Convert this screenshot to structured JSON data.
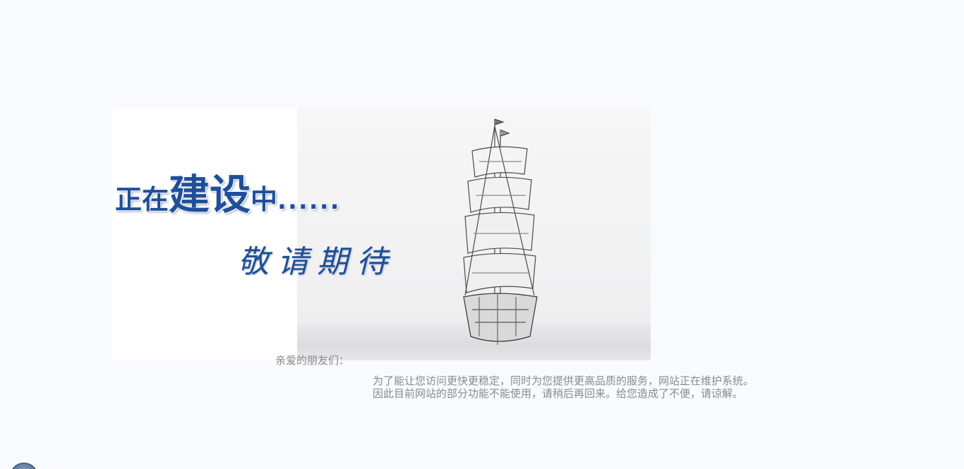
{
  "banner": {
    "headline_part1": "正在",
    "headline_part2": "建设",
    "headline_part3": "中",
    "headline_dots": "......",
    "subline": "敬请期待",
    "image_icon": "sailing-ship-illustration"
  },
  "notice": {
    "greeting": "亲爱的朋友们：",
    "line1": "为了能让您访问更快更稳定，同时为您提供更高品质的服务，网站正在维护系统。",
    "line2": "因此目前网站的部分功能不能使用，请稍后再回来。给您造成了不便，请谅解。"
  },
  "corner": {
    "icon": "circle-badge-icon"
  },
  "colors": {
    "background": "#f9fafe",
    "headline": "#1f4f9a",
    "body_text": "#8a8a8a"
  }
}
